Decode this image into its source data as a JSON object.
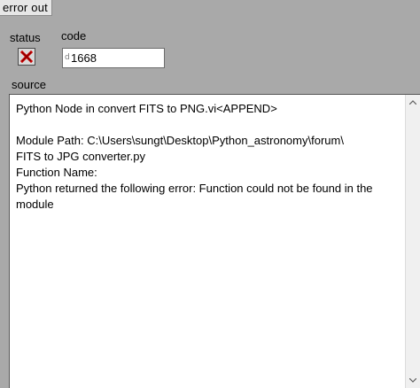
{
  "cluster": {
    "title": "error out"
  },
  "status": {
    "label": "status",
    "icon": "error-x-icon",
    "value": false
  },
  "code": {
    "label": "code",
    "radix": "d",
    "value": "1668"
  },
  "source": {
    "label": "source",
    "text": "Python Node in convert FITS to PNG.vi<APPEND>\n\nModule Path: C:\\Users\\sungt\\Desktop\\Python_astronomy\\forum\\\nFITS to JPG converter.py\nFunction Name: \nPython returned the following error: Function could not be found in the module"
  }
}
